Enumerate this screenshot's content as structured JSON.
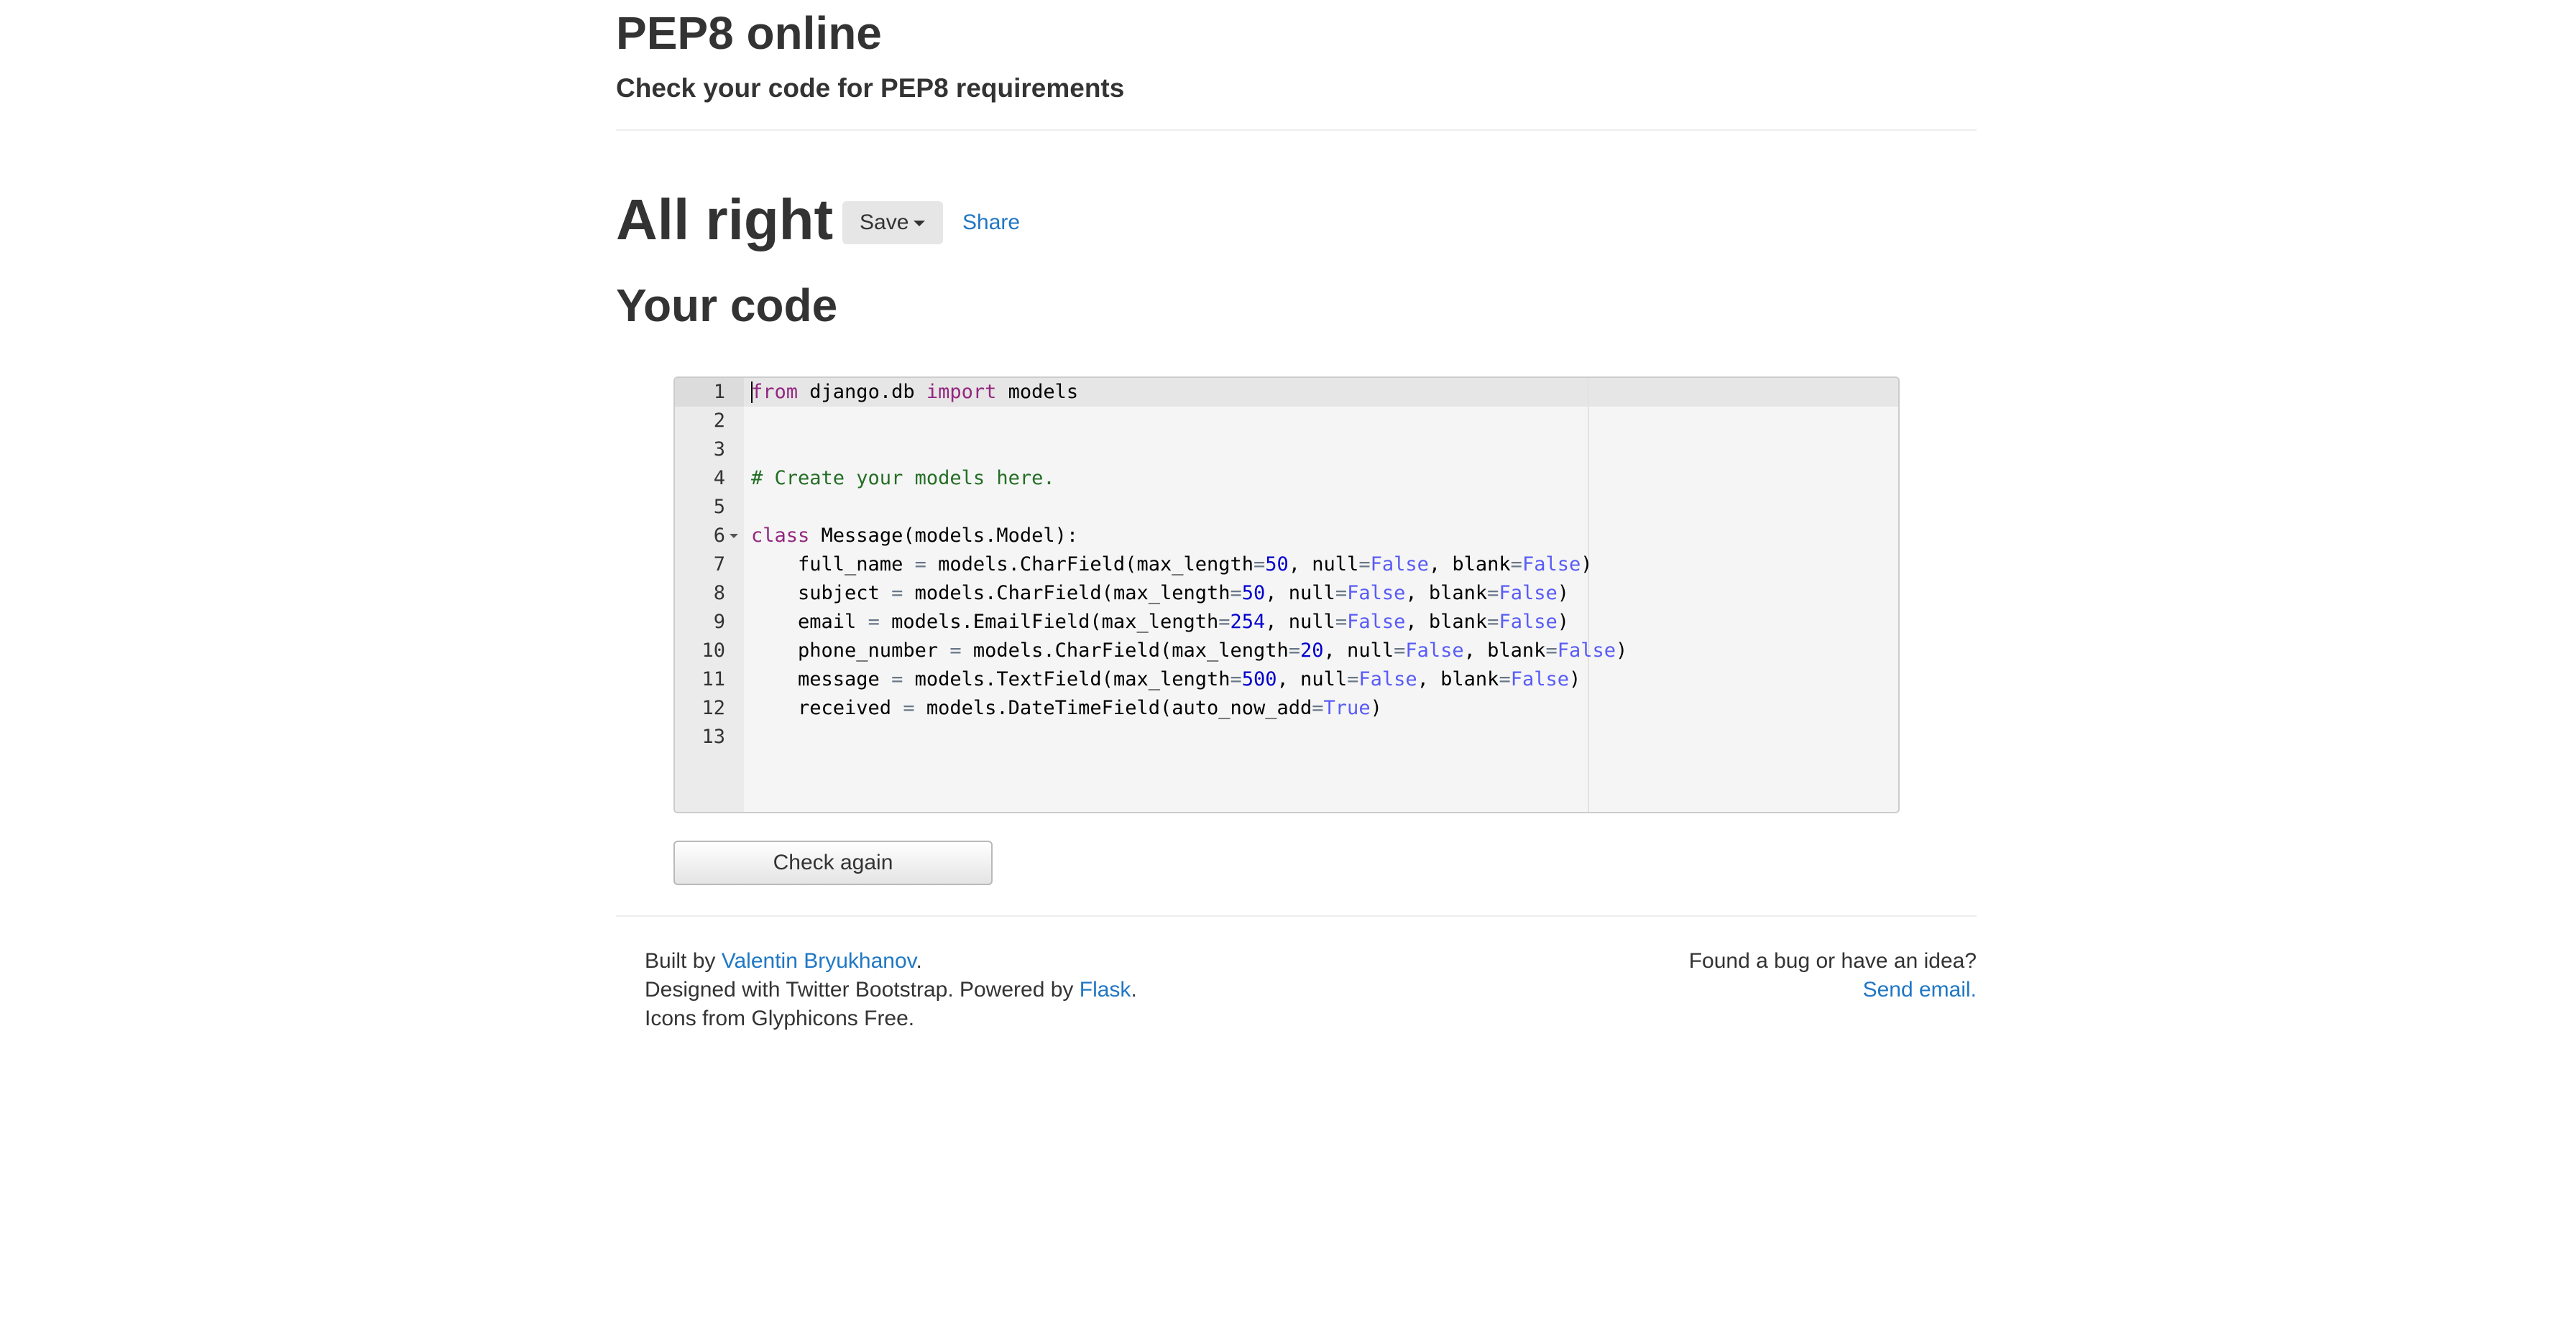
{
  "header": {
    "title": "PEP8 online",
    "subtitle": "Check your code for PEP8 requirements"
  },
  "result": {
    "title": "All right",
    "save_label": "Save",
    "share_label": "Share"
  },
  "code_section": {
    "title": "Your code",
    "check_again_label": "Check again",
    "lines": [
      {
        "n": "1",
        "tokens": [
          [
            "kw",
            "from"
          ],
          [
            "t",
            " django.db "
          ],
          [
            "kw",
            "import"
          ],
          [
            "t",
            " models"
          ]
        ]
      },
      {
        "n": "2",
        "tokens": []
      },
      {
        "n": "3",
        "tokens": []
      },
      {
        "n": "4",
        "tokens": [
          [
            "cm",
            "# Create your models here."
          ]
        ]
      },
      {
        "n": "5",
        "tokens": []
      },
      {
        "n": "6",
        "fold": true,
        "tokens": [
          [
            "kw",
            "class"
          ],
          [
            "t",
            " Message(models.Model):"
          ]
        ]
      },
      {
        "n": "7",
        "tokens": [
          [
            "t",
            "    full_name "
          ],
          [
            "op",
            "="
          ],
          [
            "t",
            " models.CharField(max_length"
          ],
          [
            "op",
            "="
          ],
          [
            "num",
            "50"
          ],
          [
            "t",
            ", null"
          ],
          [
            "op",
            "="
          ],
          [
            "bool",
            "False"
          ],
          [
            "t",
            ", blank"
          ],
          [
            "op",
            "="
          ],
          [
            "bool",
            "False"
          ],
          [
            "t",
            ")"
          ]
        ]
      },
      {
        "n": "8",
        "tokens": [
          [
            "t",
            "    subject "
          ],
          [
            "op",
            "="
          ],
          [
            "t",
            " models.CharField(max_length"
          ],
          [
            "op",
            "="
          ],
          [
            "num",
            "50"
          ],
          [
            "t",
            ", null"
          ],
          [
            "op",
            "="
          ],
          [
            "bool",
            "False"
          ],
          [
            "t",
            ", blank"
          ],
          [
            "op",
            "="
          ],
          [
            "bool",
            "False"
          ],
          [
            "t",
            ")"
          ]
        ]
      },
      {
        "n": "9",
        "tokens": [
          [
            "t",
            "    email "
          ],
          [
            "op",
            "="
          ],
          [
            "t",
            " models.EmailField(max_length"
          ],
          [
            "op",
            "="
          ],
          [
            "num",
            "254"
          ],
          [
            "t",
            ", null"
          ],
          [
            "op",
            "="
          ],
          [
            "bool",
            "False"
          ],
          [
            "t",
            ", blank"
          ],
          [
            "op",
            "="
          ],
          [
            "bool",
            "False"
          ],
          [
            "t",
            ")"
          ]
        ]
      },
      {
        "n": "10",
        "tokens": [
          [
            "t",
            "    phone_number "
          ],
          [
            "op",
            "="
          ],
          [
            "t",
            " models.CharField(max_length"
          ],
          [
            "op",
            "="
          ],
          [
            "num",
            "20"
          ],
          [
            "t",
            ", null"
          ],
          [
            "op",
            "="
          ],
          [
            "bool",
            "False"
          ],
          [
            "t",
            ", blank"
          ],
          [
            "op",
            "="
          ],
          [
            "bool",
            "False"
          ],
          [
            "t",
            ")"
          ]
        ]
      },
      {
        "n": "11",
        "tokens": [
          [
            "t",
            "    message "
          ],
          [
            "op",
            "="
          ],
          [
            "t",
            " models.TextField(max_length"
          ],
          [
            "op",
            "="
          ],
          [
            "num",
            "500"
          ],
          [
            "t",
            ", null"
          ],
          [
            "op",
            "="
          ],
          [
            "bool",
            "False"
          ],
          [
            "t",
            ", blank"
          ],
          [
            "op",
            "="
          ],
          [
            "bool",
            "False"
          ],
          [
            "t",
            ")"
          ]
        ]
      },
      {
        "n": "12",
        "tokens": [
          [
            "t",
            "    received "
          ],
          [
            "op",
            "="
          ],
          [
            "t",
            " models.DateTimeField(auto_now_add"
          ],
          [
            "op",
            "="
          ],
          [
            "bool",
            "True"
          ],
          [
            "t",
            ")"
          ]
        ]
      },
      {
        "n": "13",
        "tokens": []
      }
    ]
  },
  "footer": {
    "built_by_prefix": "Built by ",
    "author_link": "Valentin Bryukhanov",
    "built_by_suffix": ".",
    "designed_prefix": "Designed with Twitter Bootstrap. Powered by ",
    "flask_link": "Flask",
    "designed_suffix": ".",
    "icons_text": "Icons from Glyphicons Free.",
    "bug_text": "Found a bug or have an idea?",
    "email_link": "Send email."
  },
  "colors": {
    "link": "#1f77c4",
    "keyword": "#93267f",
    "comment": "#236e24",
    "number": "#0000cd",
    "boolean": "#585cf6"
  }
}
